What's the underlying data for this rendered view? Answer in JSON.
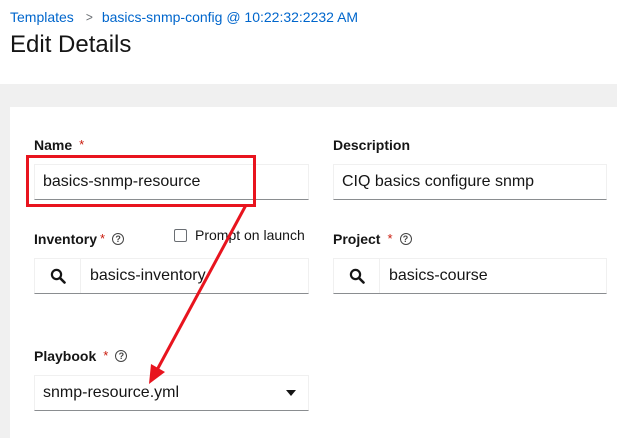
{
  "breadcrumb": {
    "root": "Templates",
    "current": "basics-snmp-config @ 10:22:32:2232 AM"
  },
  "page_title": "Edit Details",
  "form": {
    "name": {
      "label": "Name",
      "required_mark": "*",
      "value": "basics-snmp-resource"
    },
    "description": {
      "label": "Description",
      "value": "CIQ basics configure snmp"
    },
    "inventory": {
      "label": "Inventory",
      "required_mark": "*",
      "value": "basics-inventory"
    },
    "prompt_on_launch": {
      "label": "Prompt on launch",
      "checked": false
    },
    "project": {
      "label": "Project",
      "required_mark": "*",
      "value": "basics-course"
    },
    "playbook": {
      "label": "Playbook",
      "required_mark": "*",
      "value": "snmp-resource.yml"
    }
  },
  "icons": {
    "breadcrumb_separator": "chevron-right-icon",
    "help": "question-circle-icon",
    "lookup": "search-icon",
    "select": "caret-down-icon"
  },
  "help_glyph": "?",
  "colors": {
    "link": "#0066cc",
    "required": "#c9190b",
    "annotation": "#e8141e",
    "page_bg": "#f0f0f0"
  }
}
